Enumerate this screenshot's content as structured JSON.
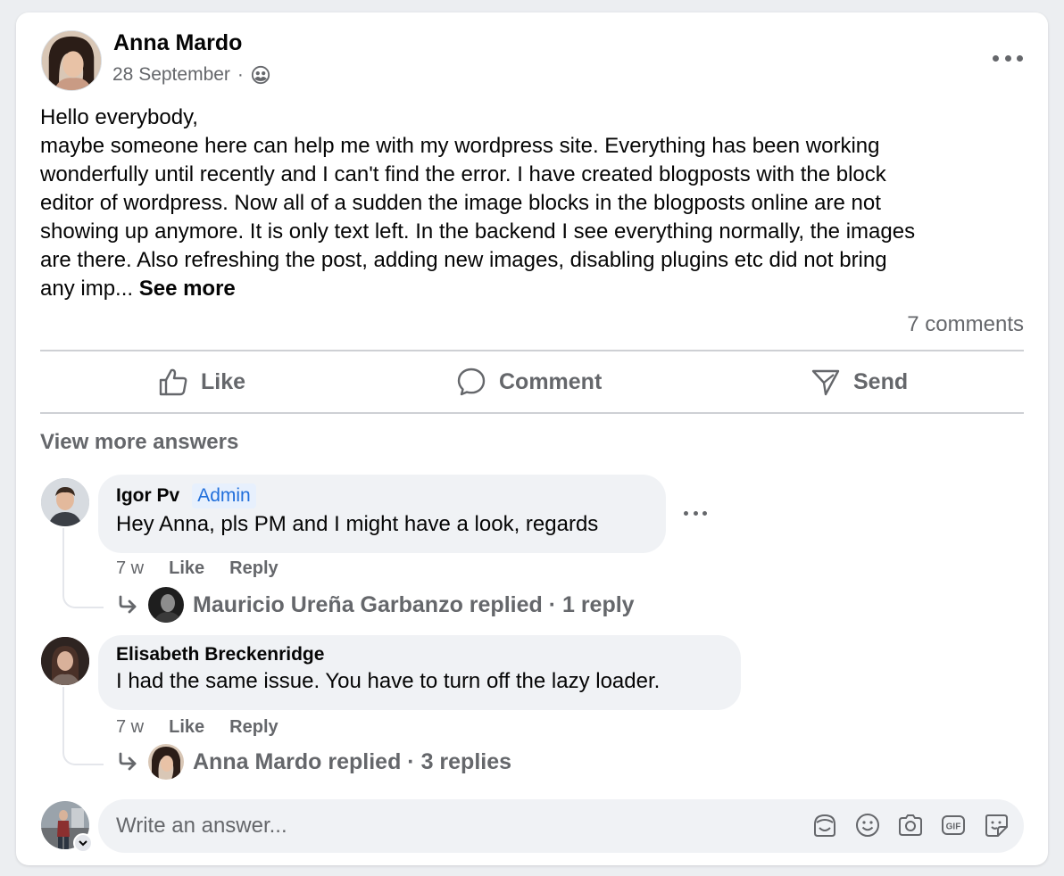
{
  "post": {
    "author": "Anna Mardo",
    "date": "28 September",
    "separator": "·",
    "audience_icon": "friends-audience-icon",
    "body_lines": [
      "Hello everybody,",
      "maybe someone here can help me with my wordpress site. Everything has been working",
      "wonderfully until recently and I can't find the error. I have created blogposts with the block",
      "editor of wordpress. Now all of a sudden the image blocks in the blogposts online are not",
      "showing up anymore. It is only text left. In the backend I see everything normally, the images",
      "are there. Also refreshing the post, adding new images, disabling plugins etc did not bring",
      "any imp..."
    ],
    "see_more": "See more",
    "comments_count": "7 comments"
  },
  "actions": {
    "like": "Like",
    "comment": "Comment",
    "send": "Send"
  },
  "view_more": "View more answers",
  "comments": [
    {
      "author": "Igor Pv",
      "badge": "Admin",
      "text": "Hey Anna, pls PM and I might have a look, regards",
      "time": "7 w",
      "like": "Like",
      "reply": "Reply",
      "replies_summary": "Mauricio Ureña Garbanzo replied · 1 reply"
    },
    {
      "author": "Elisabeth Breckenridge",
      "text": "I had the same issue. You have to turn off the lazy loader.",
      "time": "7 w",
      "like": "Like",
      "reply": "Reply",
      "replies_summary": "Anna Mardo replied · 3 replies"
    }
  ],
  "composer": {
    "placeholder": "Write an answer...",
    "tools": [
      "avatar-sticker-icon",
      "emoji-icon",
      "camera-icon",
      "gif-icon",
      "sticker-icon"
    ]
  },
  "colors": {
    "secondary_text": "#65676b",
    "bubble_bg": "#f0f2f5",
    "admin_badge": "#216fdb"
  }
}
